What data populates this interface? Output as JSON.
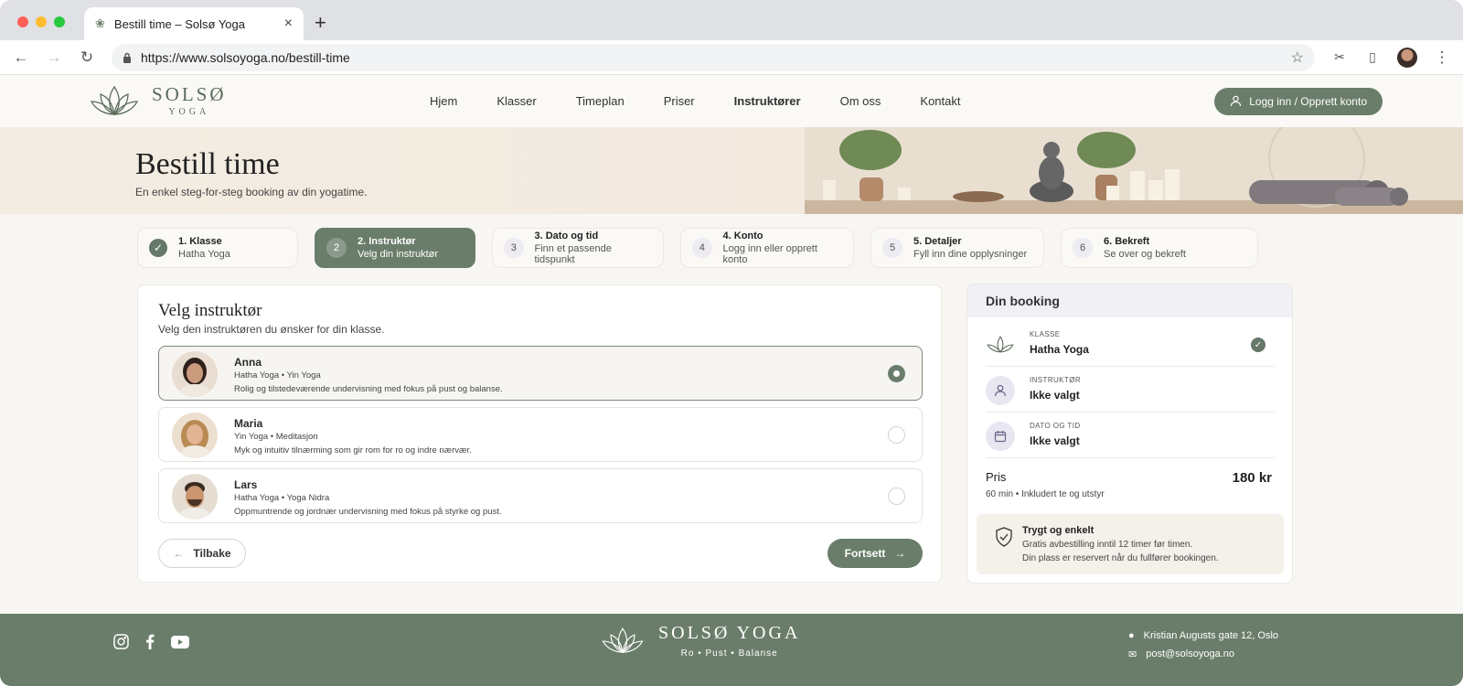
{
  "browser": {
    "tab_title": "Bestill time – Solsø Yoga",
    "url": "https://www.solsoyoga.no/bestill-time"
  },
  "header": {
    "logo_name": "SOLSØ",
    "logo_sub": "YOGA",
    "nav": [
      "Hjem",
      "Klasser",
      "Timeplan",
      "Priser",
      "Instruktører",
      "Om oss",
      "Kontakt"
    ],
    "active_nav": "Instruktører",
    "login_label": "Logg inn / Opprett konto"
  },
  "hero": {
    "title": "Bestill time",
    "subtitle": "En enkel steg-for-steg booking av din yogatime."
  },
  "steps": [
    {
      "title": "1. Klasse",
      "sub": "Hatha Yoga",
      "num": "1",
      "state": "done"
    },
    {
      "title": "2. Instruktør",
      "sub": "Velg din instruktør",
      "num": "2",
      "state": "active"
    },
    {
      "title": "3. Dato og tid",
      "sub": "Finn et passende tidspunkt",
      "num": "3",
      "state": "todo"
    },
    {
      "title": "4. Konto",
      "sub": "Logg inn eller opprett konto",
      "num": "4",
      "state": "todo"
    },
    {
      "title": "5. Detaljer",
      "sub": "Fyll inn dine opplysninger",
      "num": "5",
      "state": "todo"
    },
    {
      "title": "6. Bekreft",
      "sub": "Se over og bekreft",
      "num": "6",
      "state": "todo"
    }
  ],
  "instructor_card": {
    "title": "Velg instruktør",
    "subtitle": "Velg den instruktøren du ønsker for din klasse.",
    "instructors": [
      {
        "name": "Anna",
        "tags": "Hatha Yoga  •  Yin Yoga",
        "desc": "Rolig og tilstedeværende undervisning med fokus på pust og balanse.",
        "selected": true
      },
      {
        "name": "Maria",
        "tags": "Yin Yoga  •  Meditasjon",
        "desc": "Myk og intuitiv tilnærming som gir rom for ro og indre nærvær.",
        "selected": false
      },
      {
        "name": "Lars",
        "tags": "Hatha Yoga  •  Yoga Nidra",
        "desc": "Oppmuntrende og jordnær undervisning med fokus på styrke og pust.",
        "selected": false
      }
    ],
    "back_label": "Tilbake",
    "next_label": "Fortsett"
  },
  "booking": {
    "title": "Din booking",
    "class_label": "KLASSE",
    "class_value": "Hatha Yoga",
    "instructor_label": "INSTRUKTØR",
    "instructor_value": "Ikke valgt",
    "datetime_label": "DATO OG TID",
    "datetime_value": "Ikke valgt",
    "price_label": "Pris",
    "price_value": "180 kr",
    "price_note": "60 min  •  Inkludert te og utstyr",
    "safe_title": "Trygt og enkelt",
    "safe_line1": "Gratis avbestilling inntil 12 timer før timen.",
    "safe_line2": "Din plass er reservert når du fullfører bookingen."
  },
  "footer": {
    "name": "SOLSØ YOGA",
    "tagline": "Ro  •  Pust  •  Balanse",
    "address": "Kristian Augusts gate 12, Oslo",
    "email": "post@solsoyoga.no"
  },
  "colors": {
    "accent": "#6a7d6a",
    "lavender": "#e9e6f1",
    "background": "#f8f6f2"
  }
}
